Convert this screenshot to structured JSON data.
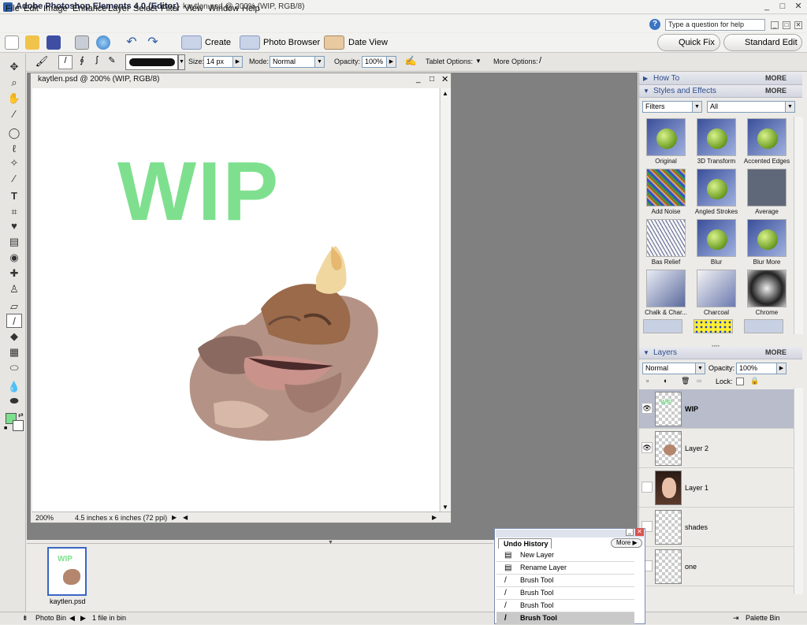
{
  "titlebar": {
    "app_name": "Adobe Photoshop Elements 4.0 (Editor)",
    "document": "kaytlen.psd @ 200% (WIP, RGB/8)"
  },
  "menus": [
    "File",
    "Edit",
    "Image",
    "Enhance",
    "Layer",
    "Select",
    "Filter",
    "View",
    "Window",
    "Help"
  ],
  "help": {
    "placeholder": "Type a question for help"
  },
  "shortcuts": {
    "create": "Create",
    "photo_browser": "Photo Browser",
    "date_view": "Date View",
    "quick_fix": "Quick Fix",
    "standard_edit": "Standard Edit"
  },
  "options": {
    "size_label": "Size:",
    "size_value": "14 px",
    "mode_label": "Mode:",
    "mode_value": "Normal",
    "opacity_label": "Opacity:",
    "opacity_value": "100%",
    "tablet_options": "Tablet Options:",
    "more_options": "More Options:"
  },
  "document": {
    "title": "kaytlen.psd @ 200% (WIP, RGB/8)",
    "zoom": "200%",
    "info": "4.5 inches x 6 inches (72 ppi)",
    "canvas_text": "WIP",
    "canvas_text_color": "#7ee08e"
  },
  "photobin": {
    "label": "Photo Bin",
    "count": "1 file in bin",
    "thumb_name": "kaytlen.psd"
  },
  "palette": {
    "how_to": "How To",
    "styles_effects": "Styles and Effects",
    "more": "MORE",
    "filters_select": "Filters",
    "all_select": "All",
    "effects": [
      "Original",
      "3D Transform",
      "Accented Edges",
      "Add Noise",
      "Angled Strokes",
      "Average",
      "Bas Relief",
      "Blur",
      "Blur More",
      "Chalk & Char...",
      "Charcoal",
      "Chrome"
    ],
    "layers_title": "Layers",
    "blend_mode": "Normal",
    "opacity_label": "Opacity:",
    "opacity_value": "100%",
    "lock_label": "Lock:",
    "layers": [
      "WIP",
      "Layer 2",
      "Layer 1",
      "shades",
      "one"
    ],
    "palette_bin": "Palette Bin"
  },
  "undo": {
    "title": "Undo History",
    "more": "More",
    "items": [
      "New Layer",
      "Rename Layer",
      "Brush Tool",
      "Brush Tool",
      "Brush Tool",
      "Brush Tool"
    ]
  },
  "colors": {
    "foreground": "#7ee08e",
    "background": "#ffffff",
    "accent": "#2d4d8c"
  }
}
